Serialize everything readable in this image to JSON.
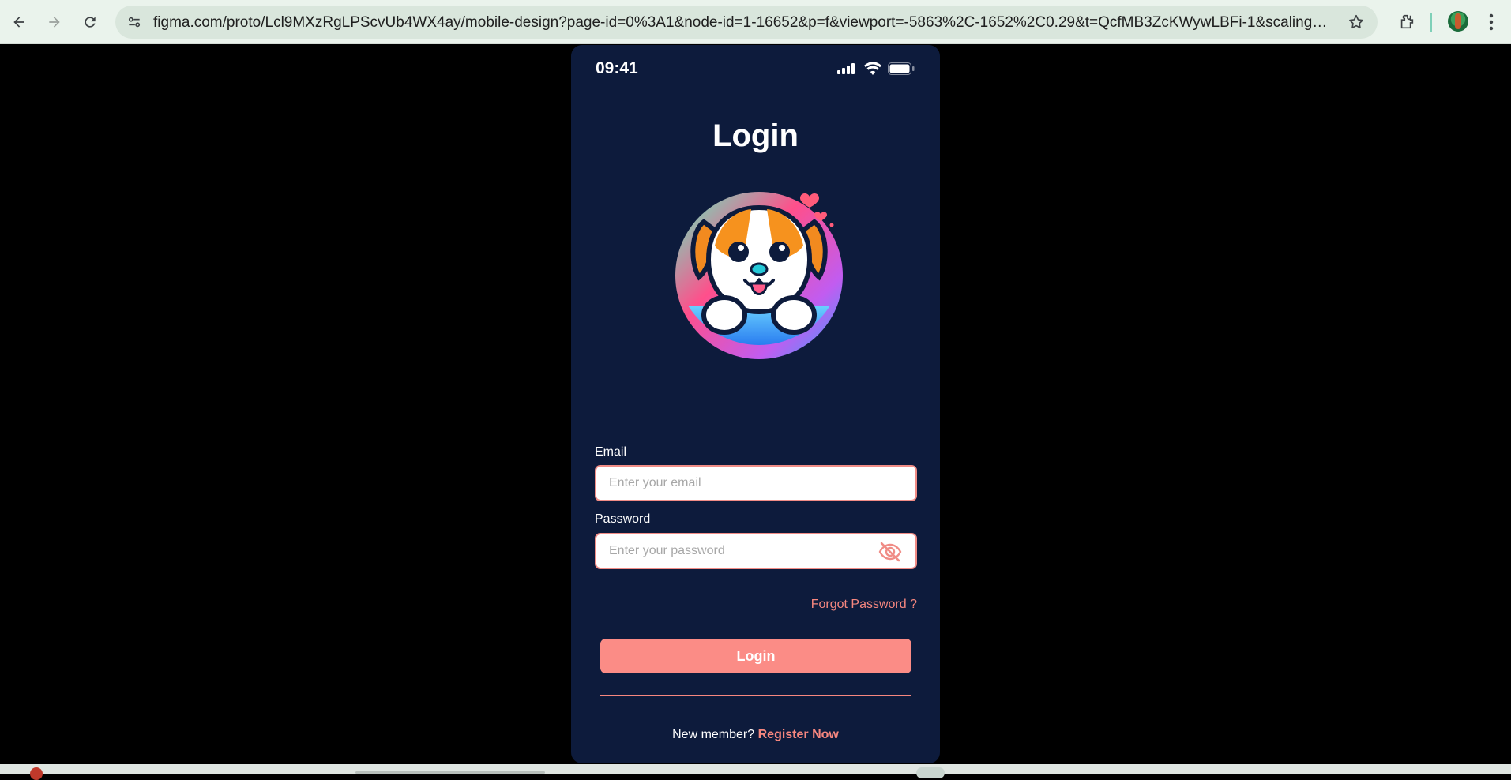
{
  "browser": {
    "url": "figma.com/proto/Lcl9MXzRgLPScvUb4WX4ay/mobile-design?page-id=0%3A1&node-id=1-16652&p=f&viewport=-5863%2C-1652%2C0.29&t=QcfMB3ZcKWywLBFi-1&scaling=min-zoom&co..."
  },
  "status_bar": {
    "time": "09:41"
  },
  "screen": {
    "title": "Login",
    "email_label": "Email",
    "email_placeholder": "Enter your email",
    "password_label": "Password",
    "password_placeholder": "Enter your password",
    "forgot_password": "Forgot Password ?",
    "login_button": "Login",
    "register_prompt": "New member?",
    "register_link": "Register Now"
  },
  "colors": {
    "screen_bg": "#0d1b3c",
    "accent": "#fb8c86",
    "link": "#f6877f"
  },
  "icons": [
    "back-arrow-icon",
    "forward-arrow-icon",
    "reload-icon",
    "site-info-icon",
    "star-icon",
    "extensions-icon",
    "kebab-menu-icon",
    "signal-icon",
    "wifi-icon",
    "battery-icon",
    "eye-off-icon"
  ]
}
